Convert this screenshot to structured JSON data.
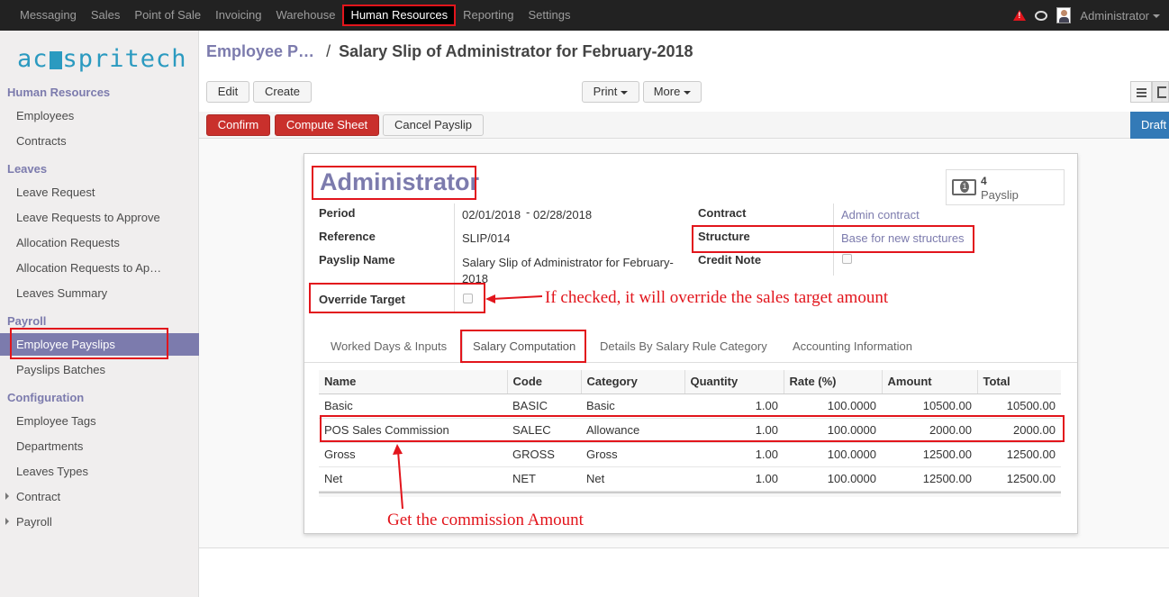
{
  "topbar": {
    "menu": [
      "Messaging",
      "Sales",
      "Point of Sale",
      "Invoicing",
      "Warehouse",
      "Human Resources",
      "Reporting",
      "Settings"
    ],
    "user": "Administrator"
  },
  "sidebar": {
    "logo": "ac spritech",
    "sections": {
      "hr": "Human Resources",
      "leaves": "Leaves",
      "payroll": "Payroll",
      "configuration": "Configuration"
    },
    "items": {
      "employees": "Employees",
      "contracts": "Contracts",
      "leave_request": "Leave Request",
      "leave_requests_to_approve": "Leave Requests to Approve",
      "allocation_requests": "Allocation Requests",
      "allocation_requests_to_ap": "Allocation Requests to Ap…",
      "leaves_summary": "Leaves Summary",
      "employee_payslips": "Employee Payslips",
      "payslips_batches": "Payslips Batches",
      "employee_tags": "Employee Tags",
      "departments": "Departments",
      "leaves_types": "Leaves Types",
      "contract": "Contract",
      "payroll": "Payroll"
    }
  },
  "breadcrumb": {
    "parent": "Employee P…",
    "separator": "/",
    "current": "Salary Slip of Administrator for February-2018"
  },
  "toolbar": {
    "edit": "Edit",
    "create": "Create",
    "print": "Print",
    "more": "More"
  },
  "statusbar": {
    "confirm": "Confirm",
    "compute_sheet": "Compute Sheet",
    "cancel_payslip": "Cancel Payslip",
    "state": "Draft"
  },
  "form": {
    "employee": "Administrator",
    "payslip_count": "4",
    "payslip_label": "Payslip",
    "period_label": "Period",
    "period_from": "02/01/2018",
    "period_sep": "-",
    "period_to": "02/28/2018",
    "reference_label": "Reference",
    "reference": "SLIP/014",
    "payslip_name_label": "Payslip Name",
    "payslip_name": "Salary Slip of Administrator for February-2018",
    "override_label": "Override Target",
    "contract_label": "Contract",
    "contract": "Admin contract",
    "structure_label": "Structure",
    "structure": "Base for new structures",
    "credit_note_label": "Credit Note"
  },
  "tabs": [
    "Worked Days & Inputs",
    "Salary Computation",
    "Details By Salary Rule Category",
    "Accounting Information"
  ],
  "table": {
    "headers": [
      "Name",
      "Code",
      "Category",
      "Quantity",
      "Rate (%)",
      "Amount",
      "Total"
    ],
    "rows": [
      [
        "Basic",
        "BASIC",
        "Basic",
        "1.00",
        "100.0000",
        "10500.00",
        "10500.00"
      ],
      [
        "POS Sales Commission",
        "SALEC",
        "Allowance",
        "1.00",
        "100.0000",
        "2000.00",
        "2000.00"
      ],
      [
        "Gross",
        "GROSS",
        "Gross",
        "1.00",
        "100.0000",
        "12500.00",
        "12500.00"
      ],
      [
        "Net",
        "NET",
        "Net",
        "1.00",
        "100.0000",
        "12500.00",
        "12500.00"
      ]
    ]
  },
  "annotations": {
    "override": "If checked, it will override the sales target amount",
    "commission": "Get the commission Amount"
  },
  "colors": {
    "accent": "#7c7bad",
    "highlight": "#e2151c",
    "primary_button": "#c9302c",
    "draft": "#337ab7"
  }
}
